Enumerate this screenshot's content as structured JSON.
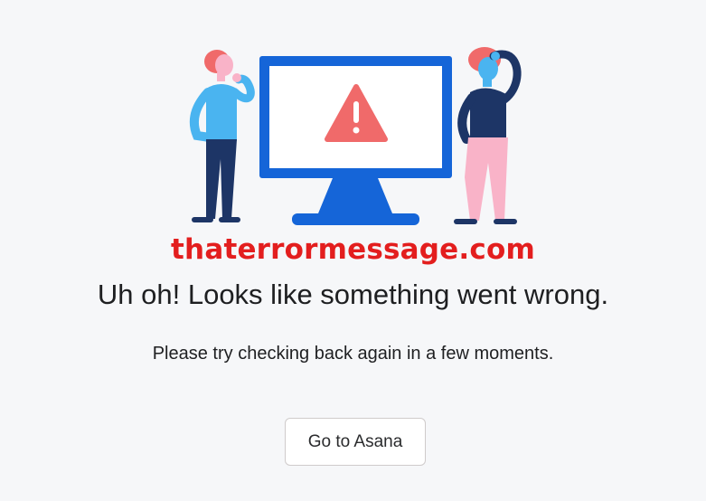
{
  "illustration": {
    "icon": "error-illustration-icon",
    "warning_icon": "warning-triangle-icon",
    "colors": {
      "monitor": "#1565d8",
      "warning": "#f06a6a",
      "person_left_shirt": "#4ab4f0",
      "person_right_pants": "#f9b3c8",
      "hair": "#f06a6a",
      "navy": "#1d3566"
    }
  },
  "watermark": {
    "text": "thaterrormessage.com",
    "color": "#e31e1e"
  },
  "error": {
    "title": "Uh oh! Looks like something went wrong.",
    "message": "Please try checking back again in a few moments."
  },
  "actions": {
    "go_to_asana_label": "Go to Asana"
  }
}
